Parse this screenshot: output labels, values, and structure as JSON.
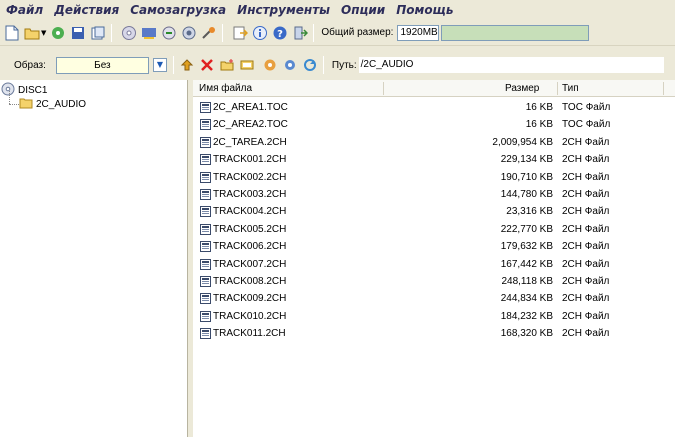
{
  "menu": [
    "Файл",
    "Действия",
    "Самозагрузка",
    "Инструменты",
    "Опции",
    "Помощь"
  ],
  "toolbar": {
    "total_label": "Общий размер:",
    "total_value": "1920MB",
    "total_fill_fraction": 1.0,
    "icons": [
      "new-icon",
      "open-icon",
      "wizard-icon",
      "save-icon",
      "properties-icon",
      "burn-icon",
      "mount-icon",
      "extract-icon",
      "network-icon",
      "tools-icon",
      "export-icon",
      "info-icon",
      "help-icon",
      "exit-icon"
    ]
  },
  "image_bar": {
    "image_label": "Образ:",
    "image_value": "Без",
    "path_label": "Путь:",
    "path_value": "/2C_AUDIO",
    "icons": [
      "up-folder-icon",
      "delete-icon",
      "new-folder-icon",
      "rename-icon",
      "add-files-icon",
      "settings-icon",
      "refresh-icon"
    ]
  },
  "tree": {
    "root": "DISC1",
    "child": "2C_AUDIO"
  },
  "columns": {
    "name": "Имя файла",
    "size": "Размер",
    "type": "Тип"
  },
  "files": [
    {
      "name": "2C_AREA1.TOC",
      "size": "16 KB",
      "type": "TOC Файл"
    },
    {
      "name": "2C_AREA2.TOC",
      "size": "16 KB",
      "type": "TOC Файл"
    },
    {
      "name": "2C_TAREA.2CH",
      "size": "2,009,954 KB",
      "type": "2CH Файл"
    },
    {
      "name": "TRACK001.2CH",
      "size": "229,134 KB",
      "type": "2CH Файл"
    },
    {
      "name": "TRACK002.2CH",
      "size": "190,710 KB",
      "type": "2CH Файл"
    },
    {
      "name": "TRACK003.2CH",
      "size": "144,780 KB",
      "type": "2CH Файл"
    },
    {
      "name": "TRACK004.2CH",
      "size": "23,316 KB",
      "type": "2CH Файл"
    },
    {
      "name": "TRACK005.2CH",
      "size": "222,770 KB",
      "type": "2CH Файл"
    },
    {
      "name": "TRACK006.2CH",
      "size": "179,632 KB",
      "type": "2CH Файл"
    },
    {
      "name": "TRACK007.2CH",
      "size": "167,442 KB",
      "type": "2CH Файл"
    },
    {
      "name": "TRACK008.2CH",
      "size": "248,118 KB",
      "type": "2CH Файл"
    },
    {
      "name": "TRACK009.2CH",
      "size": "244,834 KB",
      "type": "2CH Файл"
    },
    {
      "name": "TRACK010.2CH",
      "size": "184,232 KB",
      "type": "2CH Файл"
    },
    {
      "name": "TRACK011.2CH",
      "size": "168,320 KB",
      "type": "2CH Файл"
    }
  ]
}
